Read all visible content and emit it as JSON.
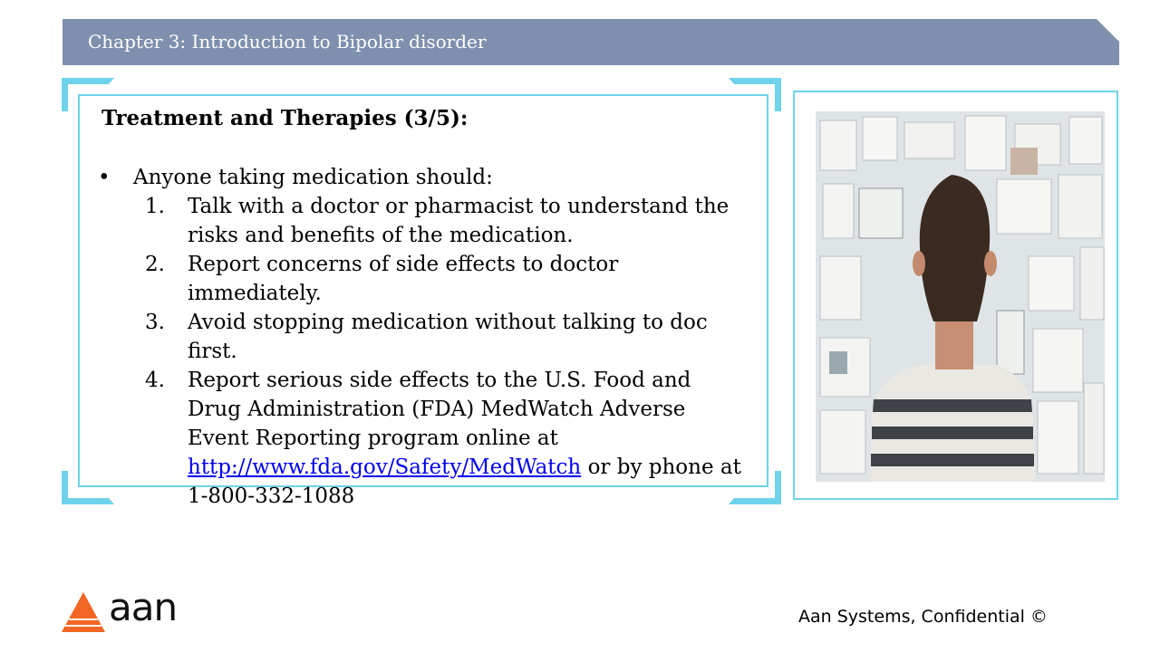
{
  "header": {
    "title": "Chapter 3: Introduction to Bipolar disorder"
  },
  "content": {
    "title": "Treatment and Therapies (3/5):",
    "bullet_symbol": "•",
    "bullet": "Anyone taking medication should:",
    "steps": [
      {
        "num": "1.",
        "text": "Talk with a doctor or pharmacist to understand the risks and benefits of the medication."
      },
      {
        "num": "2.",
        "text": "Report concerns of side effects to doctor immediately."
      },
      {
        "num": "3.",
        "text": "Avoid stopping medication without talking to doc first."
      },
      {
        "num": "4.",
        "text_before": "Report serious side effects to the U.S. Food and Drug Administration (FDA) MedWatch Adverse Event Reporting program online at",
        "link": "http://www.fda.gov/Safety/MedWatch",
        "text_after": "or by phone at 1-800-332-1088"
      }
    ]
  },
  "image": {
    "icon": "man-facing-wall-of-notes-photo"
  },
  "logo": {
    "text": "aan",
    "icon": "triangle-logo-icon"
  },
  "footer": {
    "text": "Aan Systems, Confidential ©"
  },
  "colors": {
    "header": "#7f90af",
    "frame_accent": "#6ed3ea",
    "link": "#0000ee",
    "logo_orange": "#f26522"
  }
}
